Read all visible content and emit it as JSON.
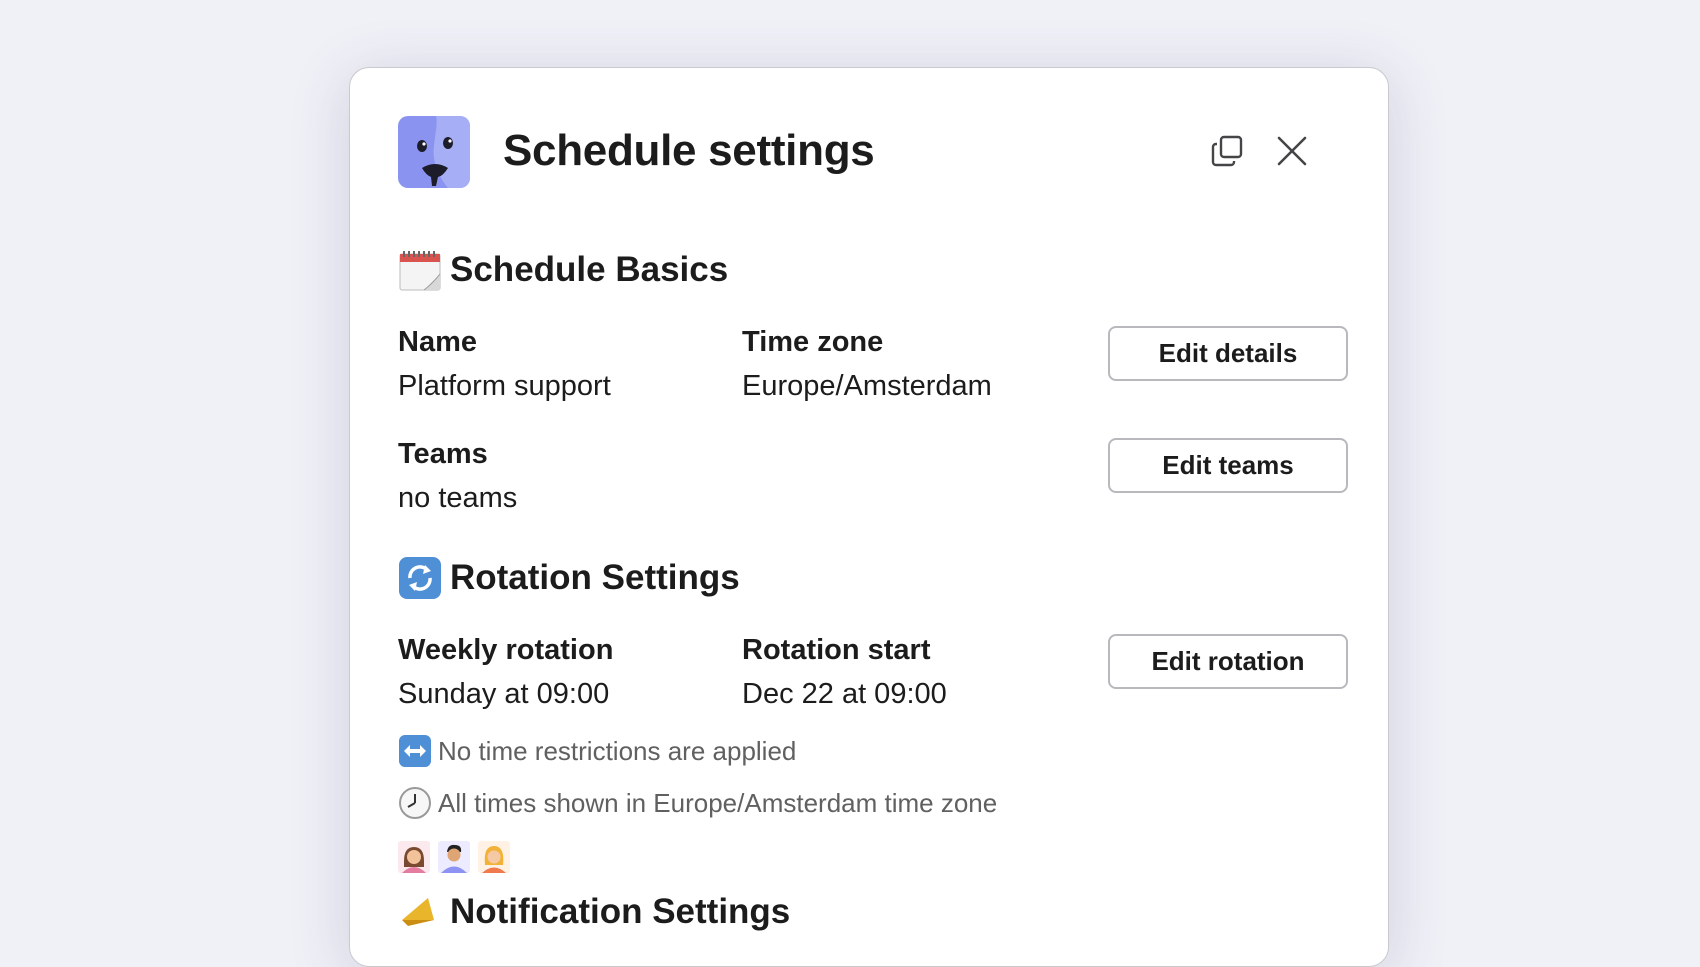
{
  "modal": {
    "title": "Schedule settings",
    "copy_icon": "copy-icon",
    "close_icon": "close-icon"
  },
  "basics": {
    "heading": "Schedule Basics",
    "icon": "calendar-icon",
    "name_label": "Name",
    "name_value": "Platform support",
    "timezone_label": "Time zone",
    "timezone_value": "Europe/Amsterdam",
    "teams_label": "Teams",
    "teams_value": "no teams",
    "edit_details_label": "Edit details",
    "edit_teams_label": "Edit teams"
  },
  "rotation": {
    "heading": "Rotation Settings",
    "icon": "repeat-arrows-icon",
    "weekly_label": "Weekly rotation",
    "weekly_value": "Sunday at 09:00",
    "start_label": "Rotation start",
    "start_value": "Dec 22 at 09:00",
    "edit_rotation_label": "Edit rotation",
    "restrictions_note": "No time restrictions are applied",
    "timezone_note": "All times shown in Europe/Amsterdam time zone"
  },
  "notifications": {
    "heading": "Notification Settings",
    "icon": "megaphone-icon"
  },
  "colors": {
    "accent": "#8c93f2",
    "background": "#f0f0f7",
    "muted_text": "#616061"
  }
}
